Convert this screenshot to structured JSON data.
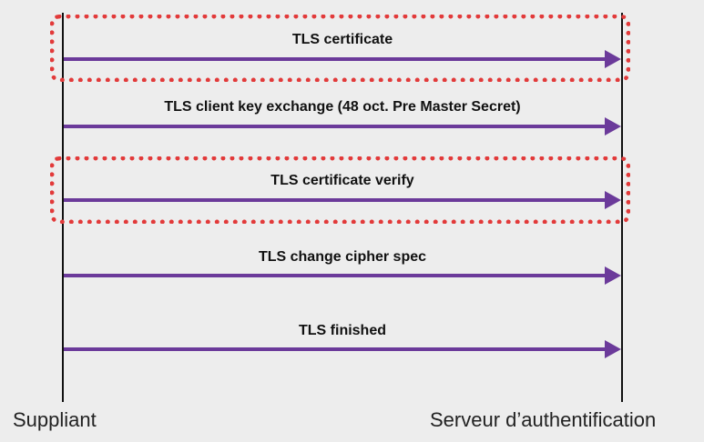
{
  "actors": {
    "left": "Suppliant",
    "right": "Serveur d’authentification"
  },
  "messages": [
    {
      "label": "TLS certificate",
      "highlighted": true
    },
    {
      "label": "TLS client key exchange (48 oct. Pre Master Secret)",
      "highlighted": false
    },
    {
      "label": "TLS certificate verify",
      "highlighted": true
    },
    {
      "label": "TLS change cipher spec",
      "highlighted": false
    },
    {
      "label": "TLS finished",
      "highlighted": false
    }
  ],
  "colors": {
    "arrow": "#6b3a9a",
    "highlight_border": "#e23a3a",
    "background": "#ededed"
  }
}
